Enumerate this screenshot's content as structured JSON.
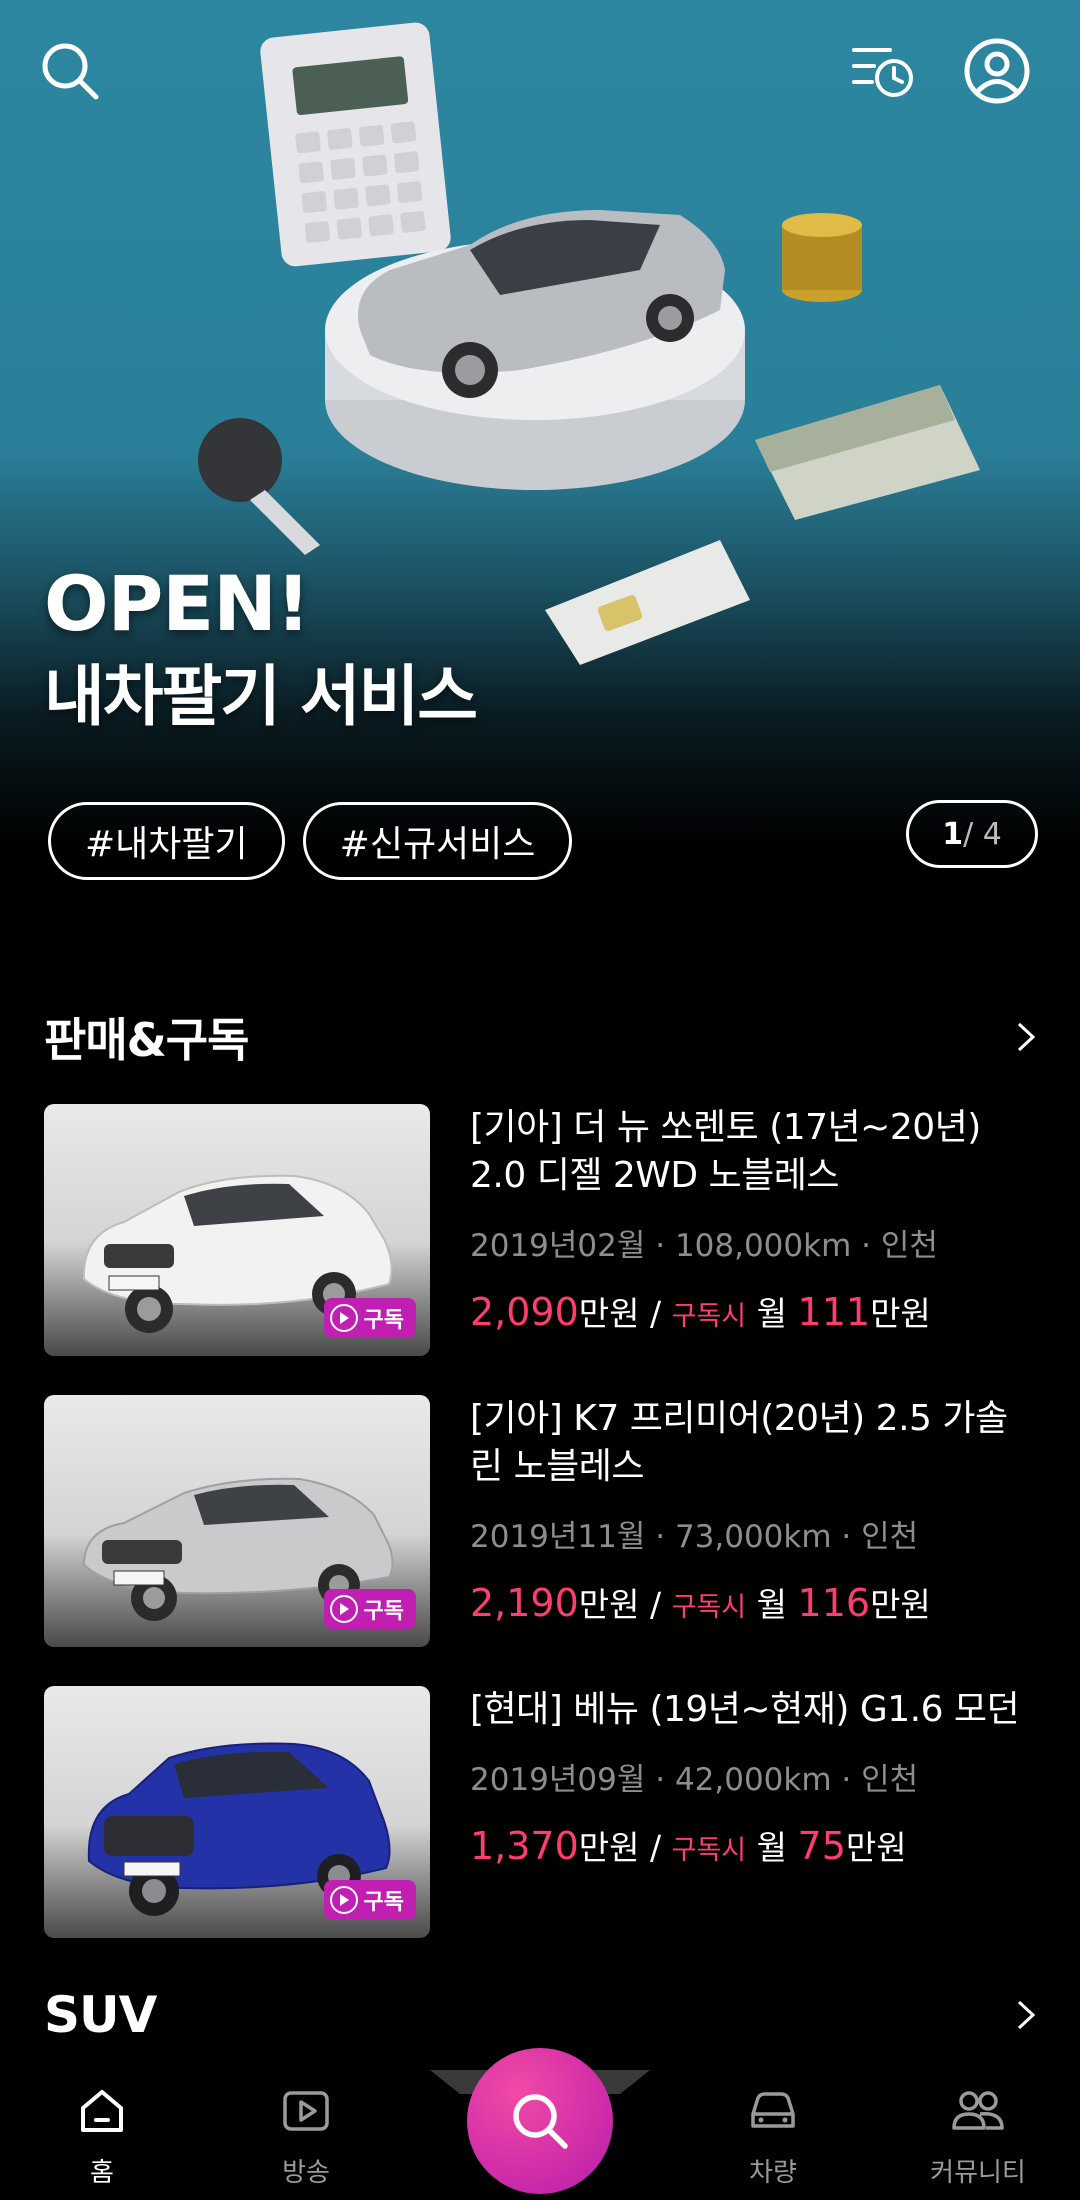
{
  "hero": {
    "title_line1": "OPEN!",
    "title_line2": "내차팔기 서비스",
    "tags": [
      "#내차팔기",
      "#신규서비스"
    ],
    "pager_current": "1",
    "pager_total": "/ 4"
  },
  "header_icons": {
    "left": "search-icon",
    "right": [
      "recent-history-icon",
      "profile-icon"
    ]
  },
  "section_sale": {
    "title": "판매&구독",
    "items": [
      {
        "title": "[기아] 더 뉴 쏘렌토 (17년~20년) 2.0 디젤 2WD 노블레스",
        "meta": "2019년02월 · 108,000km · 인천",
        "price_value": "2,090",
        "price_unit": "만원 /",
        "sub_label": "구독시",
        "month_label": "월",
        "monthly_value": "111",
        "monthly_unit": "만원",
        "badge": "구독",
        "car_color": "#f2f2f2"
      },
      {
        "title": "[기아] K7 프리미어(20년) 2.5 가솔린 노블레스",
        "meta": "2019년11월 · 73,000km · 인천",
        "price_value": "2,190",
        "price_unit": "만원 /",
        "sub_label": "구독시",
        "month_label": "월",
        "monthly_value": "116",
        "monthly_unit": "만원",
        "badge": "구독",
        "car_color": "#c9cacc"
      },
      {
        "title": "[현대] 베뉴 (19년~현재) G1.6 모던",
        "meta": "2019년09월 · 42,000km · 인천",
        "price_value": "1,370",
        "price_unit": "만원 /",
        "sub_label": "구독시",
        "month_label": "월",
        "monthly_value": "75",
        "monthly_unit": "만원",
        "badge": "구독",
        "car_color": "#2432a8"
      }
    ]
  },
  "section_suv": {
    "title": "SUV"
  },
  "bottom_nav": {
    "items": [
      {
        "label": "홈",
        "icon": "home-icon",
        "active": true
      },
      {
        "label": "방송",
        "icon": "play-icon",
        "active": false
      },
      {
        "label": "차량",
        "icon": "car-icon",
        "active": false
      },
      {
        "label": "커뮤니티",
        "icon": "community-icon",
        "active": false
      }
    ],
    "fab_icon": "search-icon"
  },
  "colors": {
    "accent_pink": "#ff3d6e",
    "badge_purple": "#c01fb2",
    "hero_teal": "#2d87a1"
  }
}
